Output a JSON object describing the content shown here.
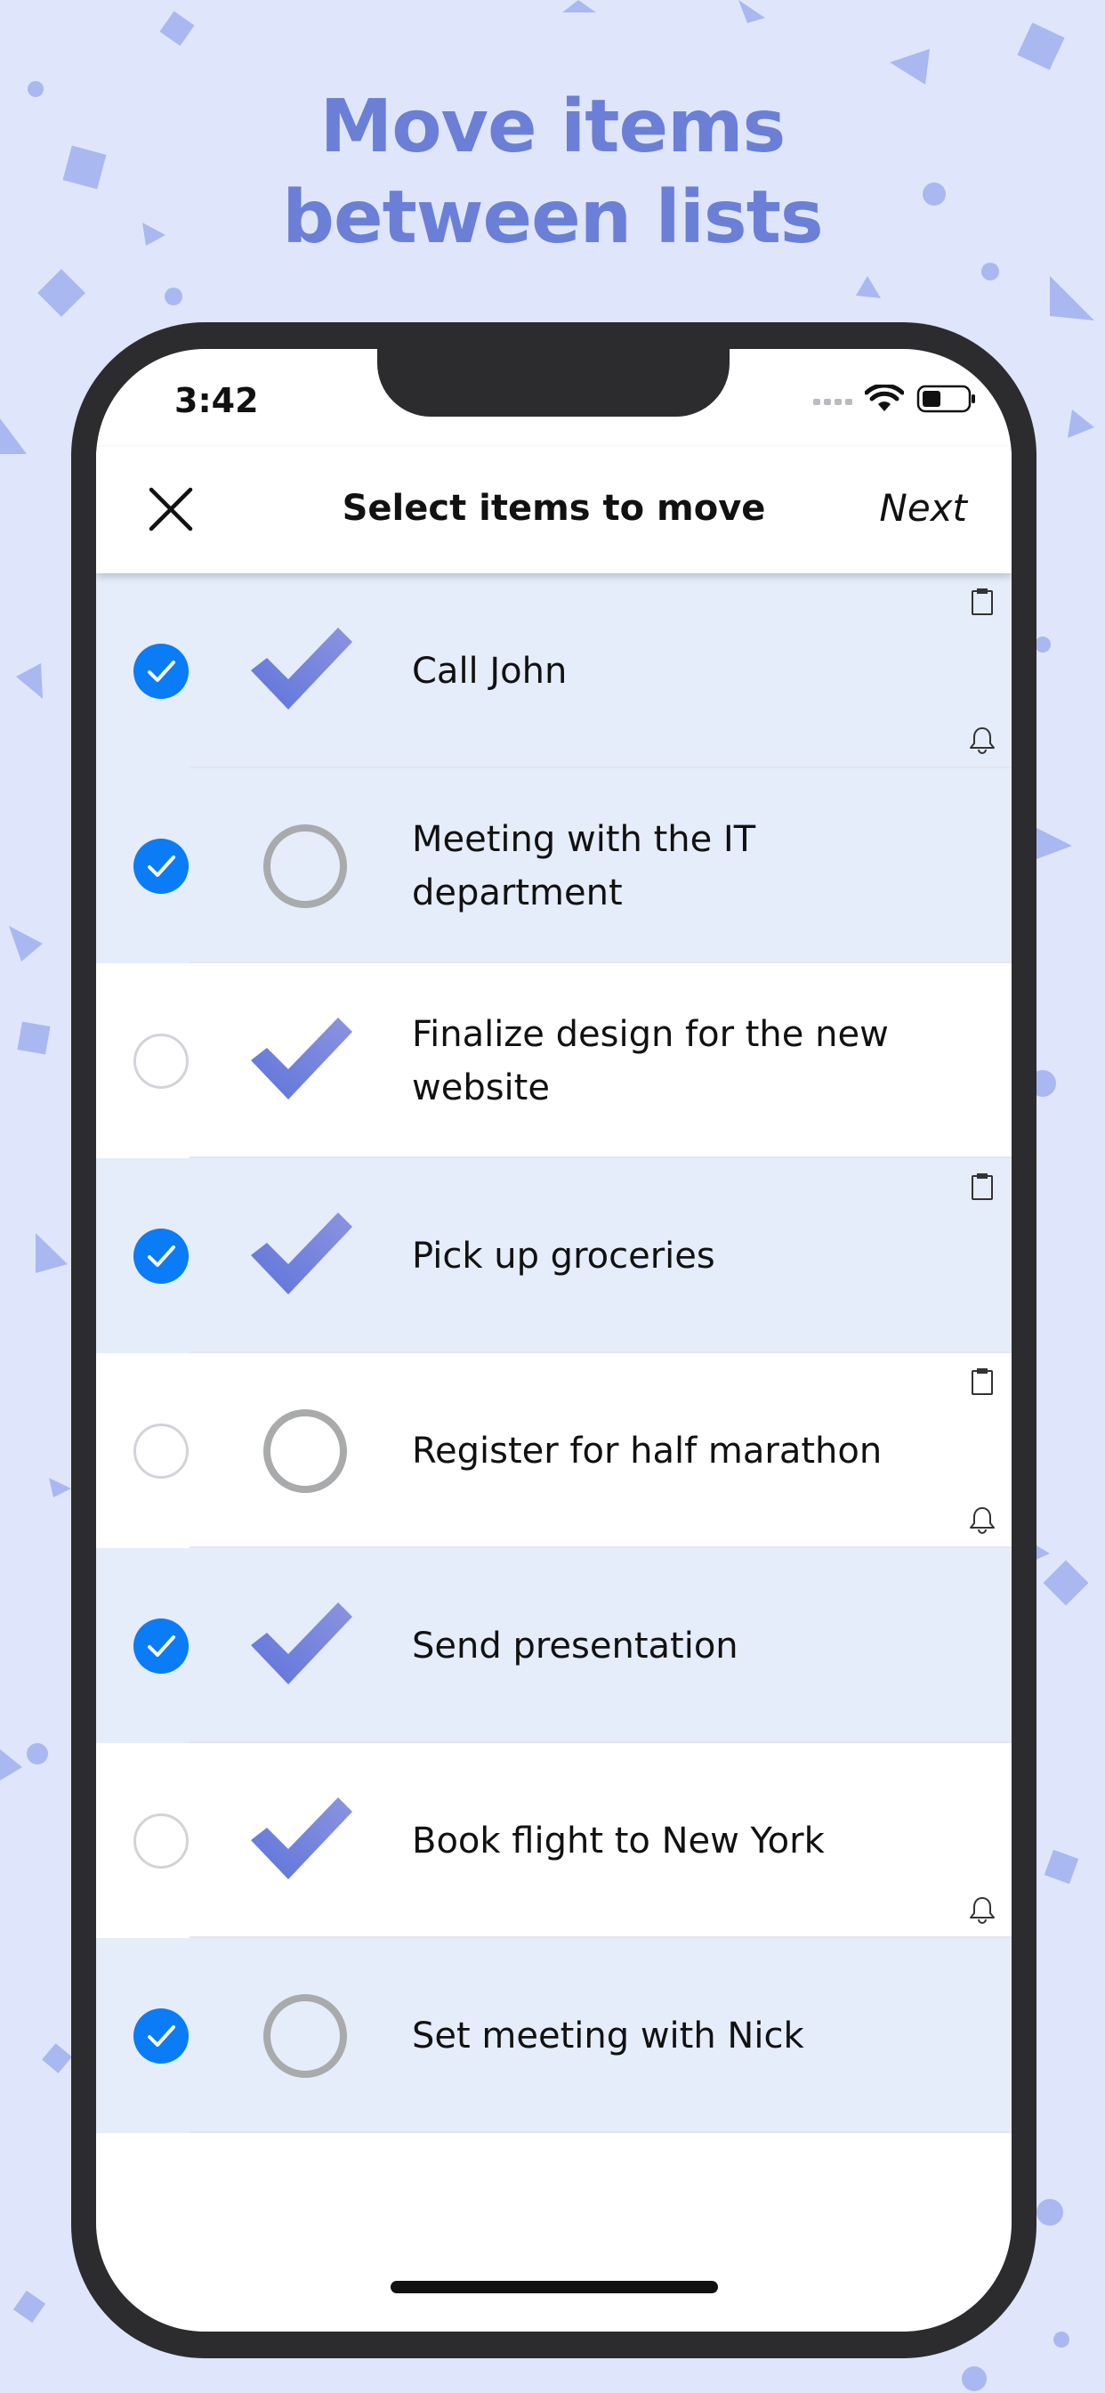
{
  "headline": {
    "line1": "Move items",
    "line2": "between lists"
  },
  "status_bar": {
    "time": "3:42"
  },
  "nav": {
    "title": "Select items to move",
    "next_label": "Next"
  },
  "colors": {
    "background": "#dfe6fb",
    "accent": "#6b7fd7",
    "select_blue": "#0a7cf6",
    "selected_row": "#e5ecfa"
  },
  "items": [
    {
      "text": "Call John",
      "selected": true,
      "completed": true,
      "has_note": true,
      "has_reminder": true
    },
    {
      "text": "Meeting with the IT department",
      "selected": true,
      "completed": false,
      "has_note": false,
      "has_reminder": false
    },
    {
      "text": "Finalize design for the new website",
      "selected": false,
      "completed": true,
      "has_note": false,
      "has_reminder": false
    },
    {
      "text": "Pick up groceries",
      "selected": true,
      "completed": true,
      "has_note": true,
      "has_reminder": false
    },
    {
      "text": "Register for half marathon",
      "selected": false,
      "completed": false,
      "has_note": true,
      "has_reminder": true
    },
    {
      "text": "Send presentation",
      "selected": true,
      "completed": true,
      "has_note": false,
      "has_reminder": false
    },
    {
      "text": "Book flight to New York",
      "selected": false,
      "completed": true,
      "has_note": false,
      "has_reminder": true
    },
    {
      "text": "Set meeting with Nick",
      "selected": true,
      "completed": false,
      "has_note": false,
      "has_reminder": false
    }
  ]
}
